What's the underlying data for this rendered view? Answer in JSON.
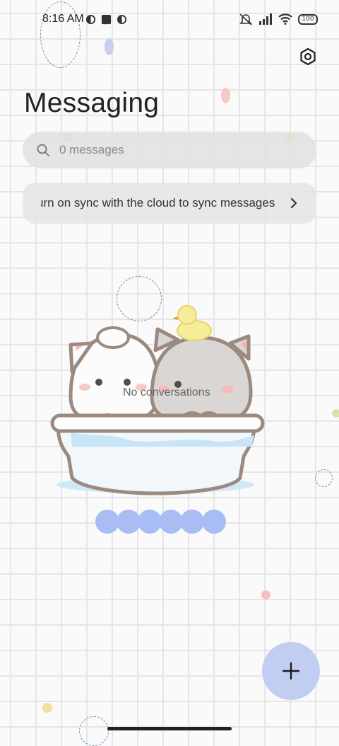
{
  "status_bar": {
    "time": "8:16 AM",
    "battery": "100"
  },
  "header": {
    "title": "Messaging",
    "settings_icon": "gear-icon"
  },
  "search": {
    "placeholder": "0 messages",
    "icon": "search-icon"
  },
  "sync_banner": {
    "text": "urn on sync with the cloud to sync messages",
    "icon": "chevron-right-icon"
  },
  "empty_state": {
    "text": "No conversations"
  },
  "fab": {
    "icon": "plus-icon"
  },
  "colors": {
    "fab": "#c2cdf2",
    "accent_blue": "#a9bdf5"
  }
}
